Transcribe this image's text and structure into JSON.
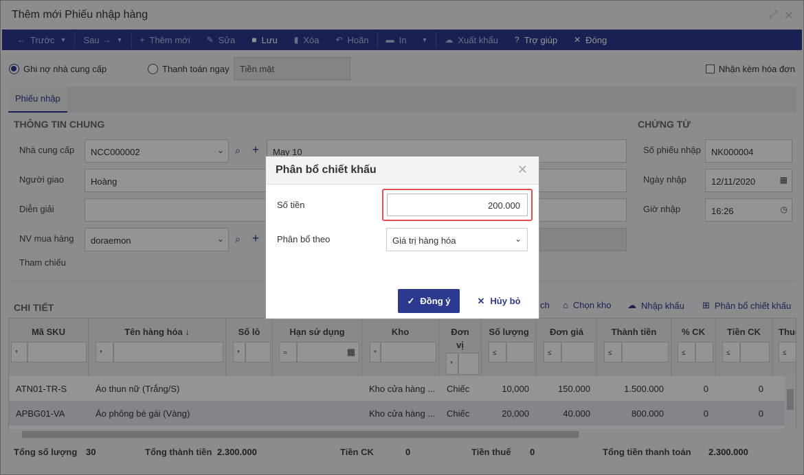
{
  "window": {
    "title": "Thêm mới Phiếu nhập hàng",
    "expand_glyph": "⤢",
    "close_glyph": "✕"
  },
  "toolbar": {
    "prev": "Trước",
    "next": "Sau",
    "add": "Thêm mới",
    "edit": "Sửa",
    "save": "Lưu",
    "delete": "Xóa",
    "undo": "Hoãn",
    "print": "In",
    "export": "Xuất khẩu",
    "help": "Trợ giúp",
    "close": "Đóng"
  },
  "payment": {
    "debt_label": "Ghi nợ nhà cung cấp",
    "pay_now_label": "Thanh toán ngay",
    "method_value": "Tiền mặt",
    "invoice_label": "Nhận kèm hóa đơn"
  },
  "tabs": {
    "receipt": "Phiếu nhập"
  },
  "general": {
    "title": "THÔNG TIN CHUNG",
    "supplier_label": "Nhà cung cấp",
    "supplier_code": "NCC000002",
    "supplier_name": "May 10",
    "deliverer_label": "Người giao",
    "deliverer_value": "Hoàng",
    "description_label": "Diễn giải",
    "buyer_label": "NV mua hàng",
    "buyer_value": "doraemon",
    "reference_label": "Tham chiếu"
  },
  "voucher": {
    "title": "CHỨNG TỪ",
    "number_label": "Số phiếu nhập",
    "number_value": "NK000004",
    "date_label": "Ngày nhập",
    "date_value": "12/11/2020",
    "time_label": "Giờ nhập",
    "time_value": "16:26"
  },
  "detail": {
    "title": "CHI TIẾT",
    "partial_action": "ch",
    "choose_warehouse": "Chọn kho",
    "import": "Nhập khẩu",
    "allocate_discount": "Phân bổ chiết khấu",
    "columns": [
      "Mã SKU",
      "Tên hàng hóa",
      "Số lô",
      "Hạn sử dụng",
      "Kho",
      "Đơn vị tính",
      "Số lượng",
      "Đơn giá",
      "Thành tiền",
      "% CK",
      "Tiền CK",
      "Thuế"
    ],
    "filter_ops": [
      "*",
      "*",
      "*",
      "=",
      "*",
      "*",
      "≤",
      "≤",
      "≤",
      "≤",
      "≤",
      "≤"
    ],
    "rows": [
      {
        "sku": "ATN01-TR-S",
        "name": "Áo thun nữ (Trắng/S)",
        "warehouse": "Kho cửa hàng ...",
        "unit": "Chiếc",
        "qty": "10,000",
        "price": "150.000",
        "amount": "1.500.000",
        "pct": "0",
        "disc": "0"
      },
      {
        "sku": "APBG01-VA",
        "name": "Áo phông bé gái (Vàng)",
        "warehouse": "Kho cửa hàng ...",
        "unit": "Chiếc",
        "qty": "20,000",
        "price": "40.000",
        "amount": "800.000",
        "pct": "0",
        "disc": "0"
      }
    ]
  },
  "totals": {
    "qty_label": "Tổng số lượng",
    "qty_value": "30",
    "amount_label": "Tổng thành tiền",
    "amount_value": "2.300.000",
    "discount_label": "Tiền CK",
    "discount_value": "0",
    "tax_label": "Tiền thuế",
    "tax_value": "0",
    "payment_label": "Tổng tiền thanh toán",
    "payment_value": "2.300.000"
  },
  "dialog": {
    "title": "Phân bổ chiết khấu",
    "amount_label": "Số tiền",
    "amount_value": "200.000",
    "method_label": "Phân bổ theo",
    "method_value": "Giá trị hàng hóa",
    "ok": "Đồng ý",
    "cancel": "Hủy bỏ"
  },
  "colors": {
    "primary": "#2b3990",
    "highlight": "#e74c4c"
  }
}
